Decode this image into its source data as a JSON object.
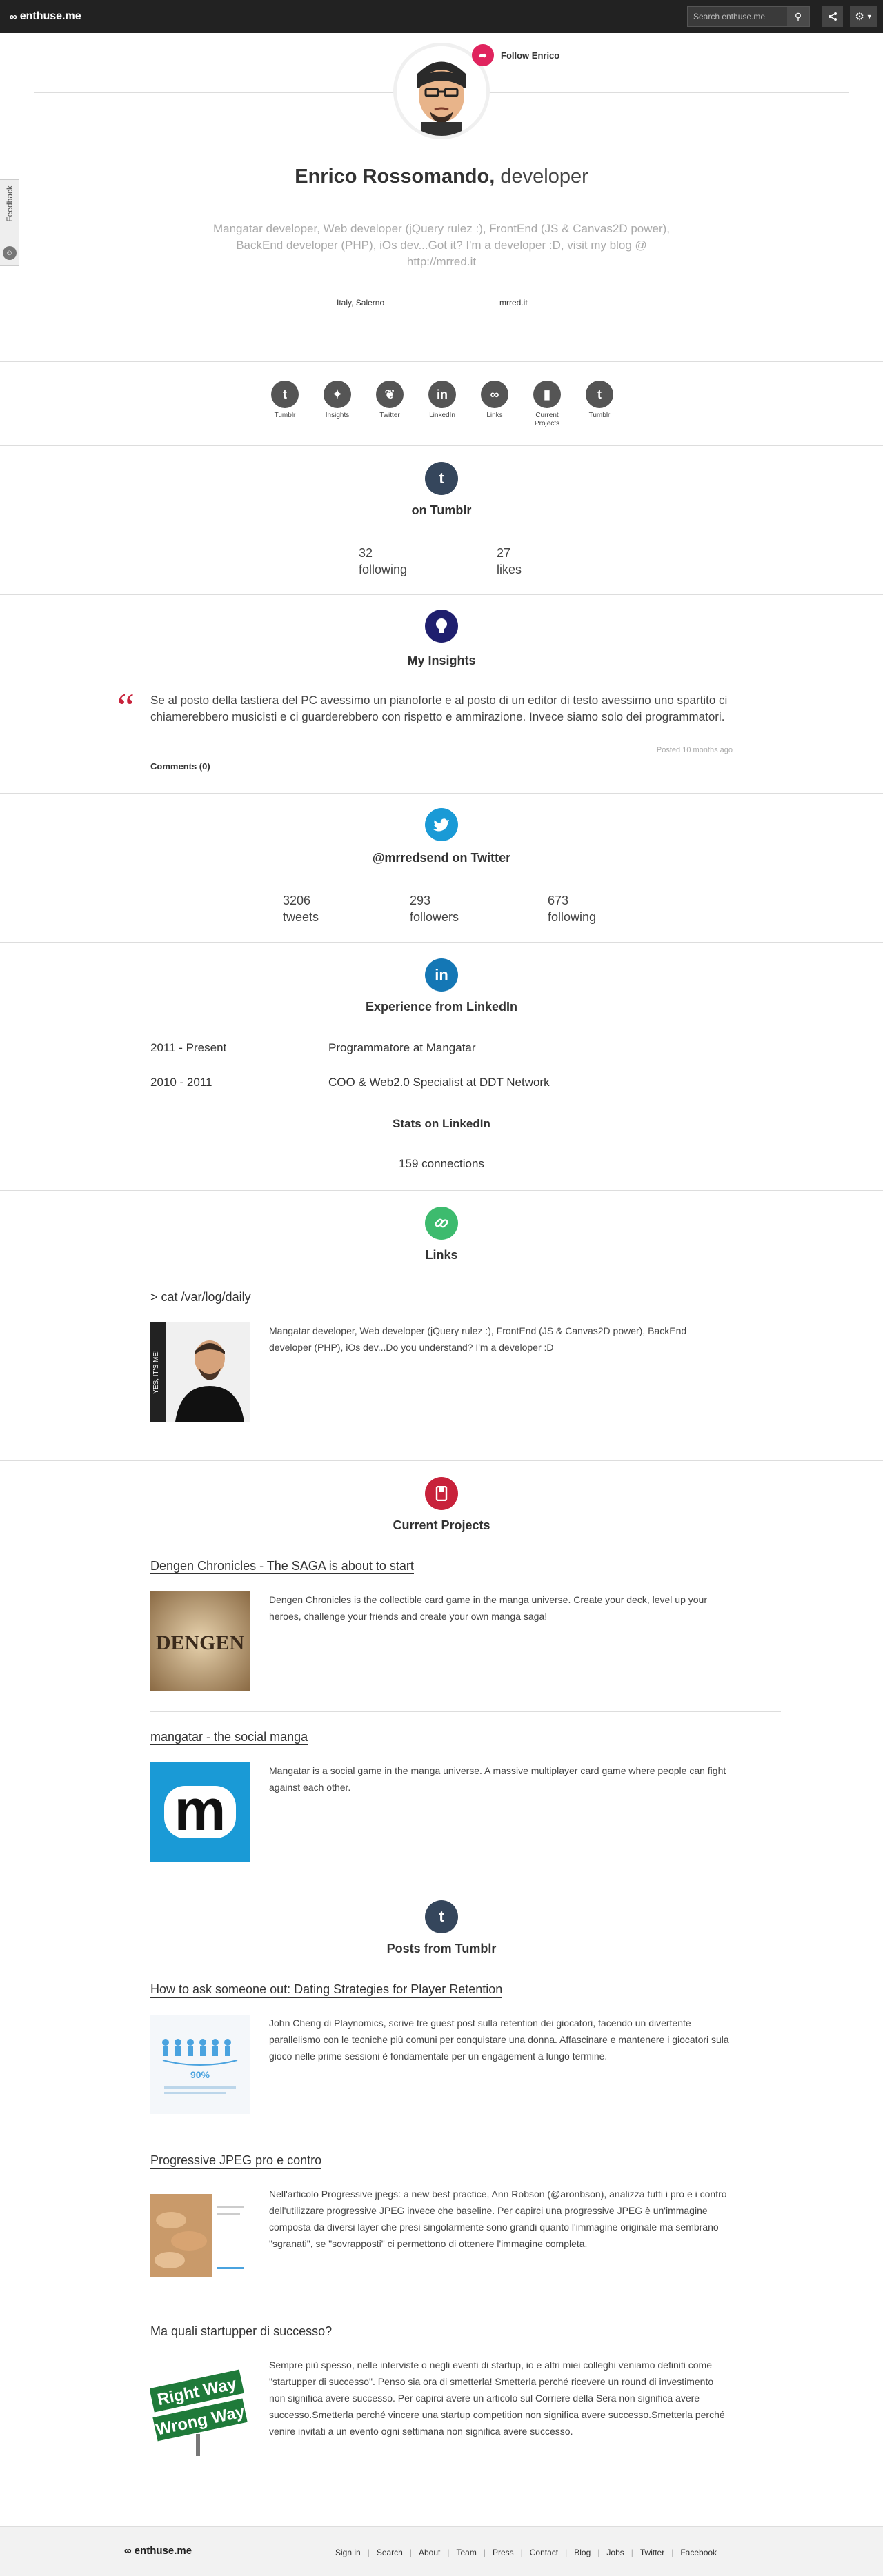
{
  "topbar": {
    "logo": "enthuse.me",
    "search_placeholder": "Search enthuse.me"
  },
  "feedback": {
    "label": "Feedback"
  },
  "profile": {
    "follow_label": "Follow Enrico",
    "name": "Enrico Rossomando,",
    "role": "developer",
    "bio": "Mangatar developer, Web developer (jQuery rulez :), FrontEnd (JS & Canvas2D power), BackEnd developer (PHP), iOs dev...Got it? I'm a developer :D, visit my blog @ http://mrred.it",
    "location": "Italy, Salerno",
    "website": "mrred.it"
  },
  "services": [
    {
      "label": "Tumblr",
      "icon": "t",
      "color": "#555"
    },
    {
      "label": "Insights",
      "icon": "bulb",
      "color": "#555"
    },
    {
      "label": "Twitter",
      "icon": "bird",
      "color": "#555"
    },
    {
      "label": "LinkedIn",
      "icon": "in",
      "color": "#555"
    },
    {
      "label": "Links",
      "icon": "link",
      "color": "#555"
    },
    {
      "label": "Current Projects",
      "icon": "book",
      "color": "#555"
    },
    {
      "label": "Tumblr",
      "icon": "t",
      "color": "#555"
    }
  ],
  "tumblr": {
    "title": "on Tumblr",
    "following_value": "32",
    "following_label": "following",
    "likes_value": "27",
    "likes_label": "likes",
    "color": "#35465c"
  },
  "insights": {
    "title": "My Insights",
    "quote": "Se al posto della tastiera del PC avessimo un pianoforte e al posto di un editor di testo avessimo uno spartito ci chiamerebbero musicisti e ci guarderebbero con rispetto e ammirazione. Invece siamo solo dei programmatori.",
    "posted": "Posted 10 months ago",
    "comments": "Comments (0)",
    "color": "#1f1f6e"
  },
  "twitter": {
    "title": "@mrredsend on Twitter",
    "tweets_value": "3206",
    "tweets_label": "tweets",
    "followers_value": "293",
    "followers_label": "followers",
    "following_value": "673",
    "following_label": "following",
    "color": "#1a9ad6"
  },
  "linkedin": {
    "title": "Experience from LinkedIn",
    "experience": [
      {
        "period": "2011 - Present",
        "role": "Programmatore at Mangatar"
      },
      {
        "period": "2010 - 2011",
        "role": "COO & Web2.0 Specialist at DDT Network"
      }
    ],
    "stats_title": "Stats on LinkedIn",
    "connections": "159 connections",
    "color": "#1477b5"
  },
  "links": {
    "title": "Links",
    "item_title": "> cat /var/log/daily",
    "item_desc": "Mangatar developer, Web developer (jQuery rulez :), FrontEnd (JS & Canvas2D power), BackEnd developer (PHP), iOs dev...Do you understand? I'm a developer :D",
    "photo_text": "YES, IT'S ME!",
    "color": "#3dbb6e"
  },
  "projects": {
    "title": "Current Projects",
    "color": "#c8223b",
    "items": [
      {
        "title": "Dengen Chronicles - The SAGA is about to start",
        "desc": "Dengen Chronicles is the collectible card game in the manga universe. Create your deck, level up your heroes, challenge your friends and create your own manga saga!",
        "thumb_text": "DENGEN"
      },
      {
        "title": "mangatar - the social manga",
        "desc": "Mangatar is a social game in the manga universe. A massive multiplayer card game where people can fight against each other.",
        "thumb_text": "m"
      }
    ]
  },
  "posts": {
    "title": "Posts from Tumblr",
    "color": "#35465c",
    "items": [
      {
        "title": "How to ask someone out: Dating Strategies for Player Retention",
        "desc": "John Cheng di Playnomics, scrive tre guest post sulla retention dei giocatori, facendo un divertente parallelismo con le tecniche più comuni per conquistare una donna. Affascinare e mantenere i giocatori sula gioco nelle prime sessioni è fondamentale per un engagement a lungo termine.",
        "thumb_text": "90%"
      },
      {
        "title": "Progressive JPEG pro e contro",
        "desc": "Nell'articolo Progressive jpegs: a new best practice, Ann Robson (@aronbson), analizza tutti i pro e i contro dell'utilizzare progressive JPEG invece che baseline. Per capirci una progressive JPEG è un'immagine composta da diversi layer che presi singolarmente sono grandi quanto l'immagine originale ma sembrano \"sgranati\", se \"sovrapposti\" ci permettono di ottenere l'immagine completa.",
        "thumb_text": ""
      },
      {
        "title": "Ma quali startupper di successo?",
        "desc": "Sempre più spesso, nelle interviste o negli eventi di startup, io e altri miei colleghi veniamo definiti come \"startupper di successo\". Penso sia ora di smetterla! Smetterla perché ricevere un round di investimento non significa avere successo. Per capirci avere un articolo sul Corriere della Sera non significa avere successo.Smetterla perché vincere una startup competition non significa avere successo.Smetterla perché venire invitati a un evento ogni settimana non significa avere successo.",
        "thumb_line1": "Right Way",
        "thumb_line2": "Wrong Way"
      }
    ]
  },
  "footer": {
    "logo": "enthuse.me",
    "links": [
      "Sign in",
      "Search",
      "About",
      "Team",
      "Press",
      "Contact",
      "Blog",
      "Jobs",
      "Twitter",
      "Facebook"
    ]
  }
}
